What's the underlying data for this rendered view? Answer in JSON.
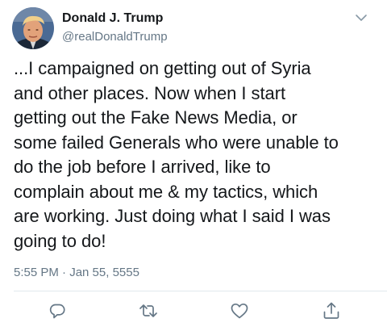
{
  "author": {
    "display_name": "Donald J. Trump",
    "handle": "@realDonaldTrump",
    "avatar_icon": "profile-photo"
  },
  "tweet": {
    "lines": [
      "...I campaigned on getting out of Syria",
      "and other places. Now when I start",
      "getting out the Fake News Media, or",
      "some failed Generals who were unable to",
      "do the job before I arrived, like to",
      "complain about me & my tactics, which",
      "are working. Just doing what I said I was",
      "going to do!"
    ],
    "timestamp": "5:55 PM · Jan 55, 5555"
  },
  "actions": {
    "reply_icon": "reply-icon",
    "retweet_icon": "retweet-icon",
    "like_icon": "heart-icon",
    "share_icon": "share-icon",
    "menu_icon": "chevron-down-icon"
  },
  "colors": {
    "text": "#14171a",
    "secondary": "#657786",
    "divider": "#e1e8ed"
  }
}
